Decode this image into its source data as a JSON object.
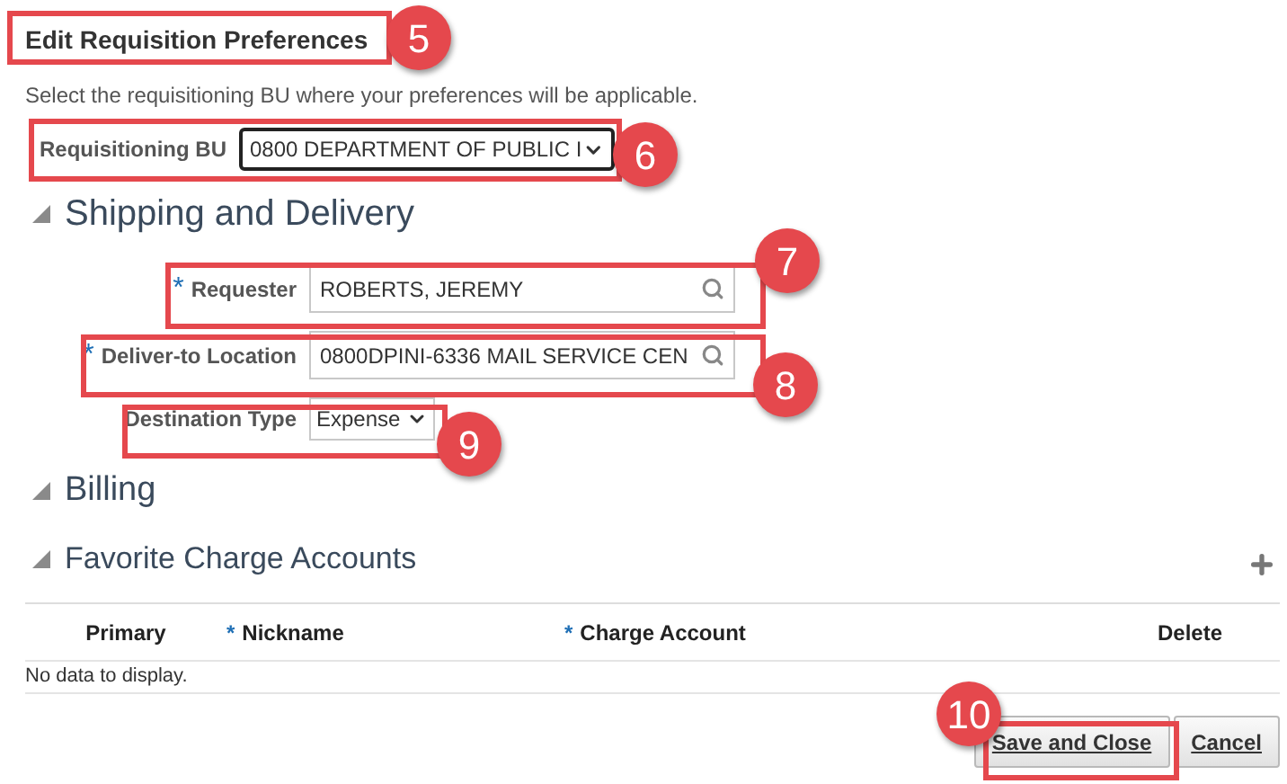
{
  "title": "Edit Requisition Preferences",
  "instruction": "Select the requisitioning BU where your preferences will be applicable.",
  "requisitioning_bu": {
    "label": "Requisitioning BU",
    "value": "0800 DEPARTMENT OF PUBLIC I"
  },
  "sections": [
    {
      "title": "Shipping and Delivery",
      "expanded": true,
      "fields": [
        {
          "marker": "*",
          "label": "Requester",
          "kind": "search",
          "value": "ROBERTS, JEREMY"
        },
        {
          "marker": "*",
          "label": "Deliver-to Location",
          "kind": "search",
          "value": "0800DPINI-6336 MAIL SERVICE CEN"
        },
        {
          "label": "Destination Type",
          "kind": "select",
          "value": "Expense"
        }
      ]
    },
    {
      "title": "Billing",
      "expanded": true
    },
    {
      "title": "Favorite Charge Accounts",
      "expanded": true
    }
  ],
  "table": {
    "columns": [
      {
        "label": "Primary"
      },
      {
        "marker": "*",
        "label": "Nickname"
      },
      {
        "marker": "*",
        "label": "Charge Account"
      },
      {
        "label": "Delete"
      }
    ],
    "empty_text": "No data to display."
  },
  "buttons": [
    {
      "label": "Save and Close"
    },
    {
      "label": "Cancel"
    }
  ],
  "callouts": [
    {
      "number": "5"
    },
    {
      "number": "6"
    },
    {
      "number": "7"
    },
    {
      "number": "8"
    },
    {
      "number": "9"
    },
    {
      "number": "10"
    }
  ]
}
